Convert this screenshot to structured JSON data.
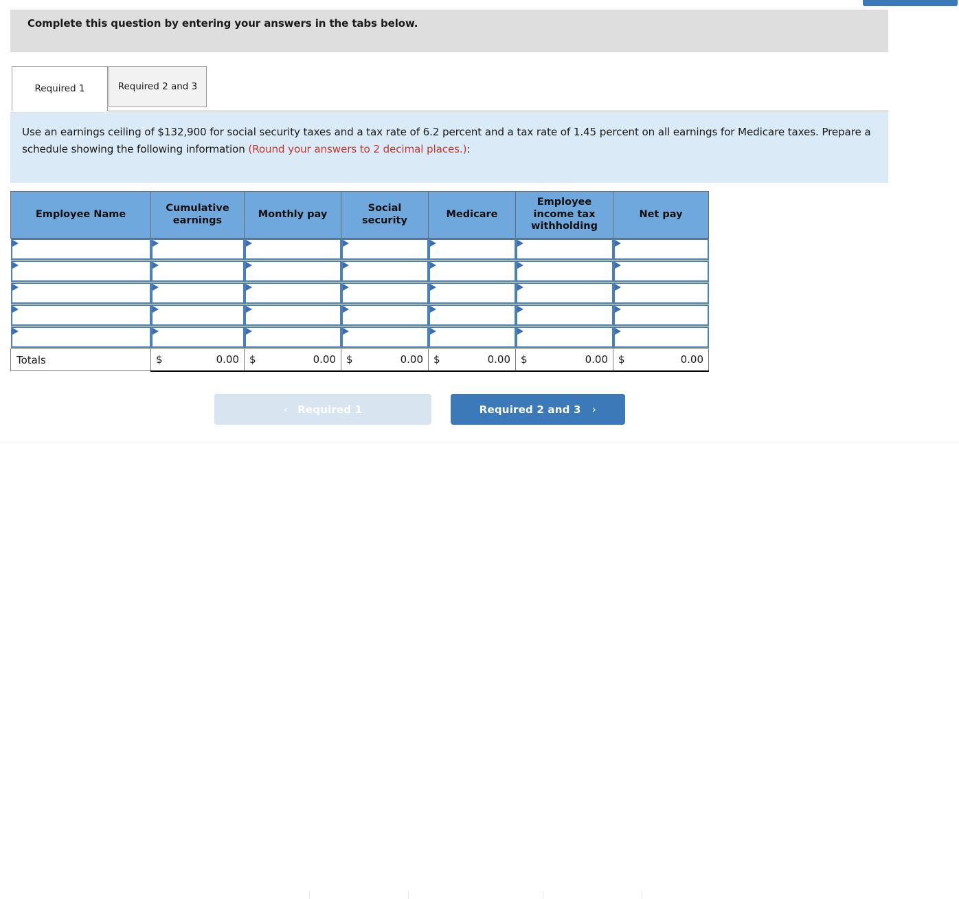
{
  "top_button": {
    "label": ""
  },
  "banner": {
    "text": "Complete this question by entering your answers in the tabs below."
  },
  "tabs": [
    {
      "label": "Required 1",
      "active": true
    },
    {
      "label": "Required 2 and 3",
      "active": false
    }
  ],
  "info": {
    "text_before": "Use an earnings ceiling of $132,900 for social security taxes and a tax rate of 6.2 percent and a tax rate of 1.45 percent on all earnings for Medicare taxes. Prepare a schedule showing the following information ",
    "text_red": "(Round your answers to 2 decimal places.)",
    "text_after": ":"
  },
  "table": {
    "headers": [
      "Employee Name",
      "Cumulative earnings",
      "Monthly pay",
      "Social security",
      "Medicare",
      "Employee income tax withholding",
      "Net pay"
    ],
    "rows": [
      [
        "",
        "",
        "",
        "",
        "",
        "",
        ""
      ],
      [
        "",
        "",
        "",
        "",
        "",
        "",
        ""
      ],
      [
        "",
        "",
        "",
        "",
        "",
        "",
        ""
      ],
      [
        "",
        "",
        "",
        "",
        "",
        "",
        ""
      ],
      [
        "",
        "",
        "",
        "",
        "",
        "",
        ""
      ]
    ],
    "totals": {
      "label": "Totals",
      "currency": "$",
      "values": [
        "0.00",
        "0.00",
        "0.00",
        "0.00",
        "0.00",
        "0.00"
      ]
    }
  },
  "nav": {
    "prev_label": "Required 1",
    "prev_chevron": "‹",
    "next_label": "Required 2 and 3",
    "next_chevron": "›"
  }
}
